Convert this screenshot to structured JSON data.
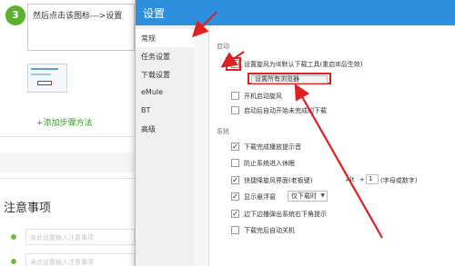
{
  "guide": {
    "step_number": "3",
    "step_text": "然后点击该图标--->设置",
    "add_method": "+添加步骤方法",
    "notice_title": "注意事项",
    "notice_placeholder_1": "未此设置输入注意事项",
    "notice_placeholder_2": "未此设置输入注意事项"
  },
  "dialog": {
    "title": "设置",
    "sidebar": [
      {
        "label": "常规",
        "active": true
      },
      {
        "label": "任务设置",
        "active": false
      },
      {
        "label": "下载设置",
        "active": false
      },
      {
        "label": "eMule",
        "active": false
      },
      {
        "label": "BT",
        "active": false
      },
      {
        "label": "高级",
        "active": false
      }
    ],
    "startup": {
      "label": "启动",
      "opt_default_tool": "设置旋风为IE默认下载工具(重启IE后生效)",
      "opt_default_tool_checked": true,
      "btn_all_browsers": "设置所有浏览器",
      "opt_autostart": "开机启动旋风",
      "opt_resume": "启动后自动开始未完成的下载"
    },
    "system": {
      "label": "系统",
      "opt_sound": "下载完成播放提示音",
      "opt_sleep": "防止系统进入休眠",
      "opt_hotkey": "快捷降旋风界面(老板键)",
      "hotkey_key": "Alt",
      "hotkey_plus": "+",
      "hotkey_value": "1",
      "hotkey_hint": "(字母或数字)",
      "opt_float": "显示悬浮窗",
      "float_value": "仅下载时",
      "opt_popup": "边下边播弹出系统右下角提示",
      "opt_shutdown": "下载完后自动关机"
    }
  },
  "colors": {
    "title_bar": "#2e8fdc",
    "annotation": "#e02020",
    "step_badge": "#5bb030"
  }
}
